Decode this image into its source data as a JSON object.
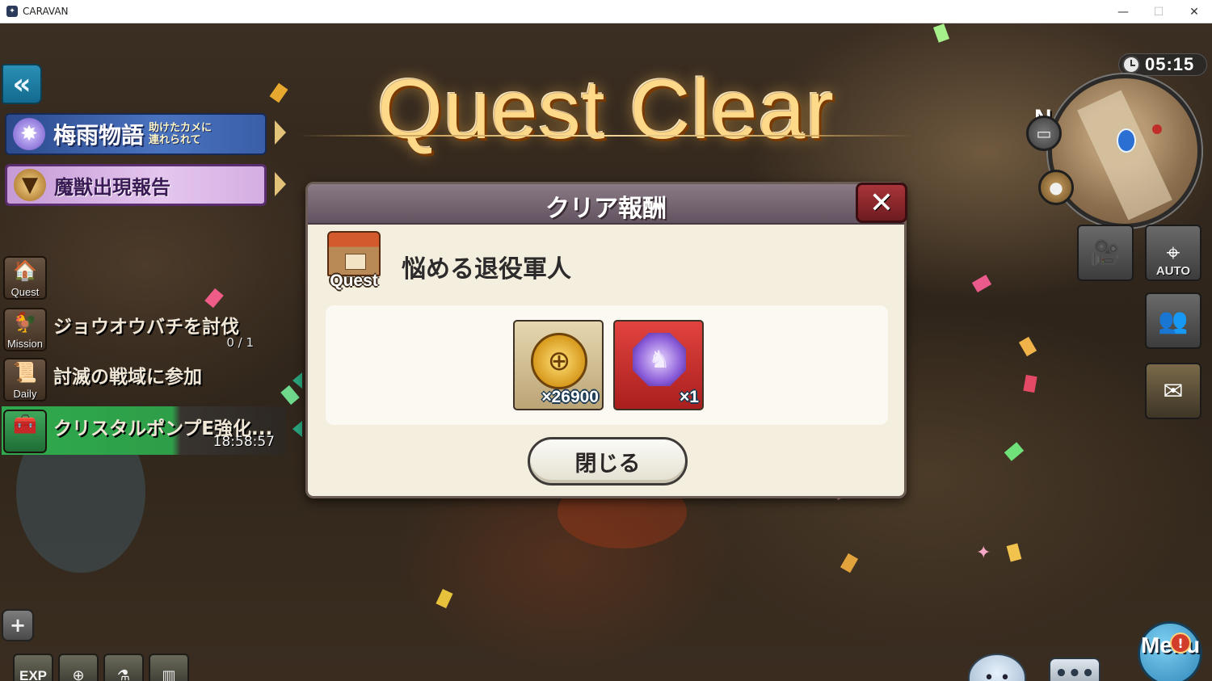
{
  "window": {
    "title": "CARAVAN",
    "app_icon": "caravan-app-icon",
    "controls": {
      "minimize": "—",
      "maximize": "☐",
      "close": "✕"
    }
  },
  "hud": {
    "back_glyph": "«",
    "timer": "05:15",
    "compass": "N",
    "auto_label": "AUTO",
    "menu_label": "Menu",
    "menu_badge": "!",
    "chat_glyph": "•••",
    "exp_label": "EXP",
    "plus_glyph": "+"
  },
  "events": [
    {
      "title": "梅雨物語",
      "subtitle_line1": "助けたカメに",
      "subtitle_line2": "連れられて"
    },
    {
      "title": "魔獣出現報告"
    }
  ],
  "quests": [
    {
      "icon_label": "Quest"
    },
    {
      "icon_label": "Mission",
      "text": "ジョウオウバチを討伐",
      "progress": "0 / 1"
    },
    {
      "icon_label": "Daily",
      "text": "討滅の戦域に参加"
    },
    {
      "text": "クリスタルポンプE強化...",
      "time": "18:58:57"
    }
  ],
  "result": {
    "headline": "Quest Clear",
    "dialog_title": "クリア報酬",
    "close_glyph": "✕",
    "badge_label": "Quest",
    "quest_name": "悩める退役軍人",
    "rewards": [
      {
        "name": "gold-coin-reward",
        "qty": "×26900"
      },
      {
        "name": "purple-crystal-reward",
        "qty": "×1"
      }
    ],
    "close_button": "閉じる"
  },
  "colors": {
    "dialog_bg": "#f3eedd",
    "header": "#6f616c",
    "close_red": "#a8353a",
    "title_gold": "#ffd98a",
    "active_green": "#2faa4e"
  }
}
